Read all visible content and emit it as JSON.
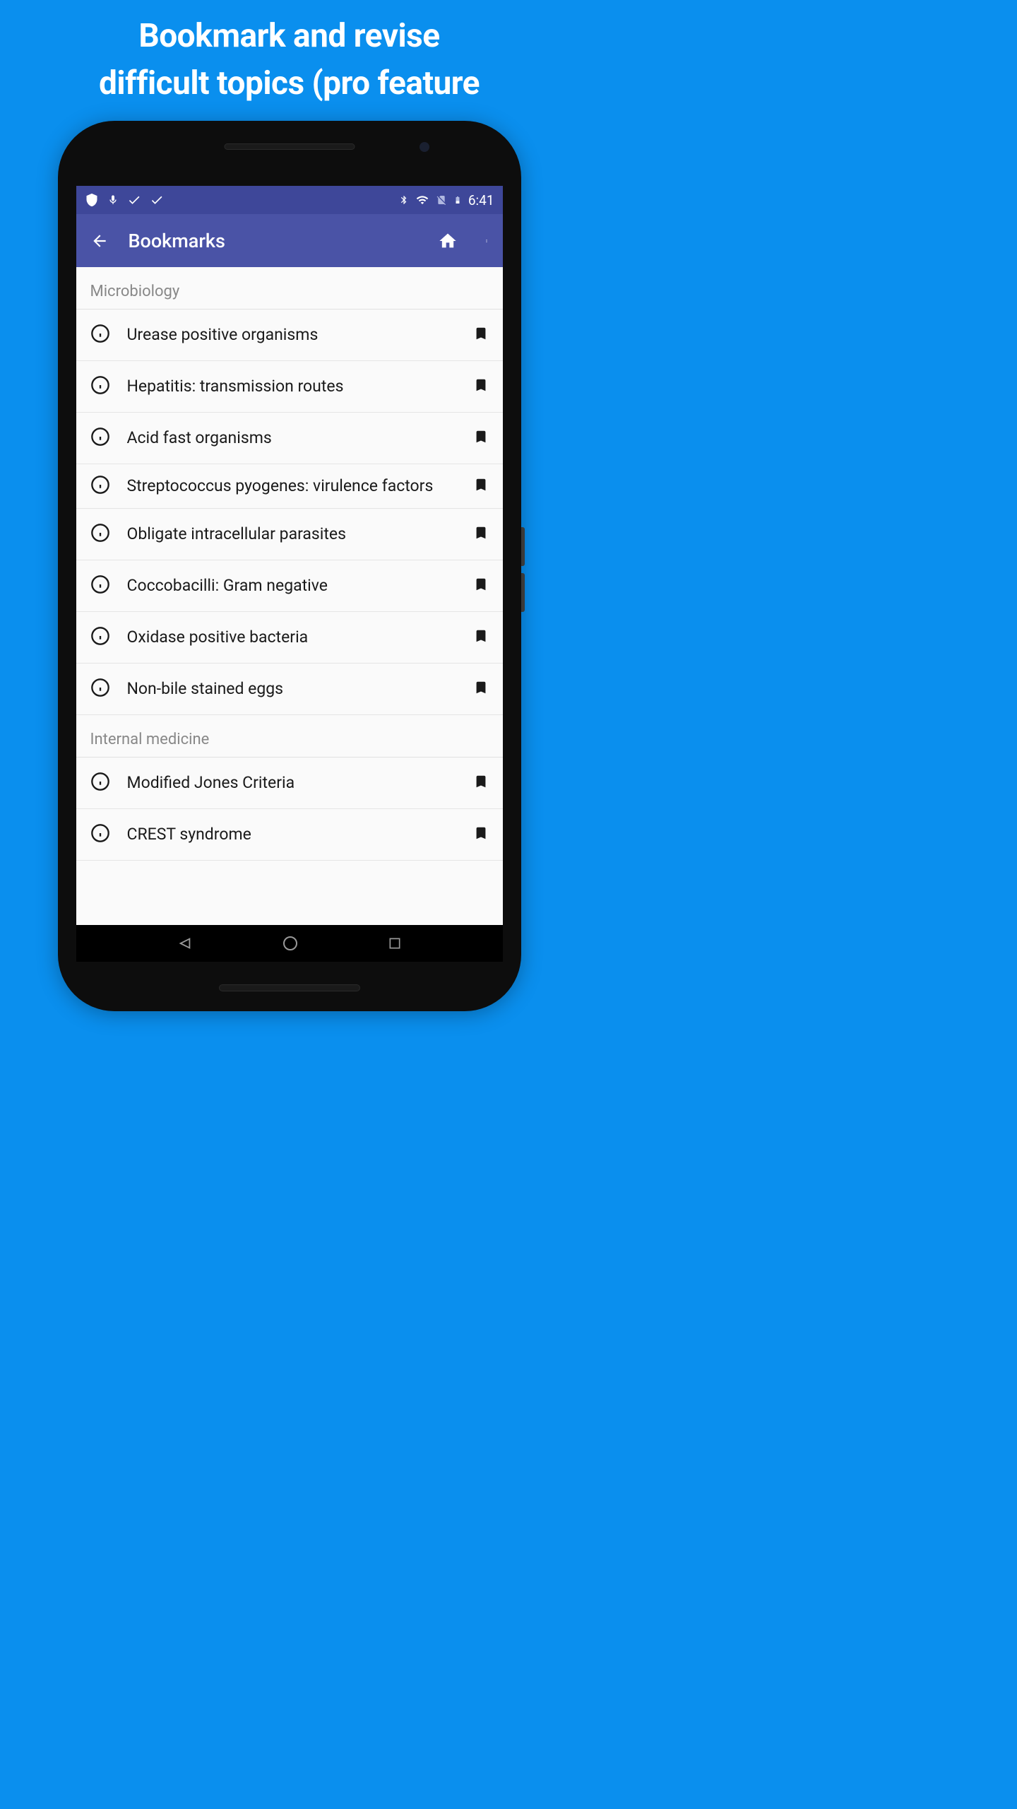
{
  "promo": {
    "line1": "Bookmark and revise",
    "line2": "difficult topics (pro feature"
  },
  "statusBar": {
    "time": "6:41"
  },
  "appBar": {
    "title": "Bookmarks"
  },
  "sections": [
    {
      "header": "Microbiology",
      "items": [
        "Urease positive organisms",
        "Hepatitis: transmission routes",
        "Acid fast organisms",
        "Streptococcus pyogenes: virulence factors",
        "Obligate intracellular parasites",
        "Coccobacilli: Gram negative",
        "Oxidase positive bacteria",
        "Non-bile stained eggs"
      ]
    },
    {
      "header": "Internal medicine",
      "items": [
        "Modified Jones Criteria",
        "CREST syndrome"
      ]
    }
  ]
}
